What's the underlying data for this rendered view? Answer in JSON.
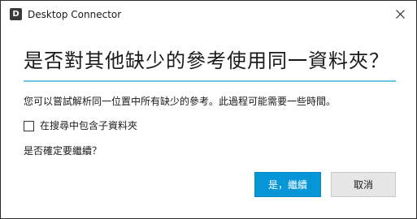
{
  "window": {
    "title": "Desktop Connector",
    "icon": "D",
    "close_icon": "close-icon"
  },
  "dialog": {
    "heading": "是否對其他缺少的參考使用同一資料夾？",
    "description": "您可以嘗試解析同一位置中所有缺少的參考。此過程可能需要一些時間。",
    "checkbox_label": "在搜尋中包含子資料夾",
    "checkbox_checked": false,
    "confirm_text": "是否確定要繼續？",
    "accent_color": "#6fc4e4"
  },
  "buttons": {
    "primary_label": "是，繼續",
    "secondary_label": "取消",
    "primary_color": "#0696d7"
  }
}
